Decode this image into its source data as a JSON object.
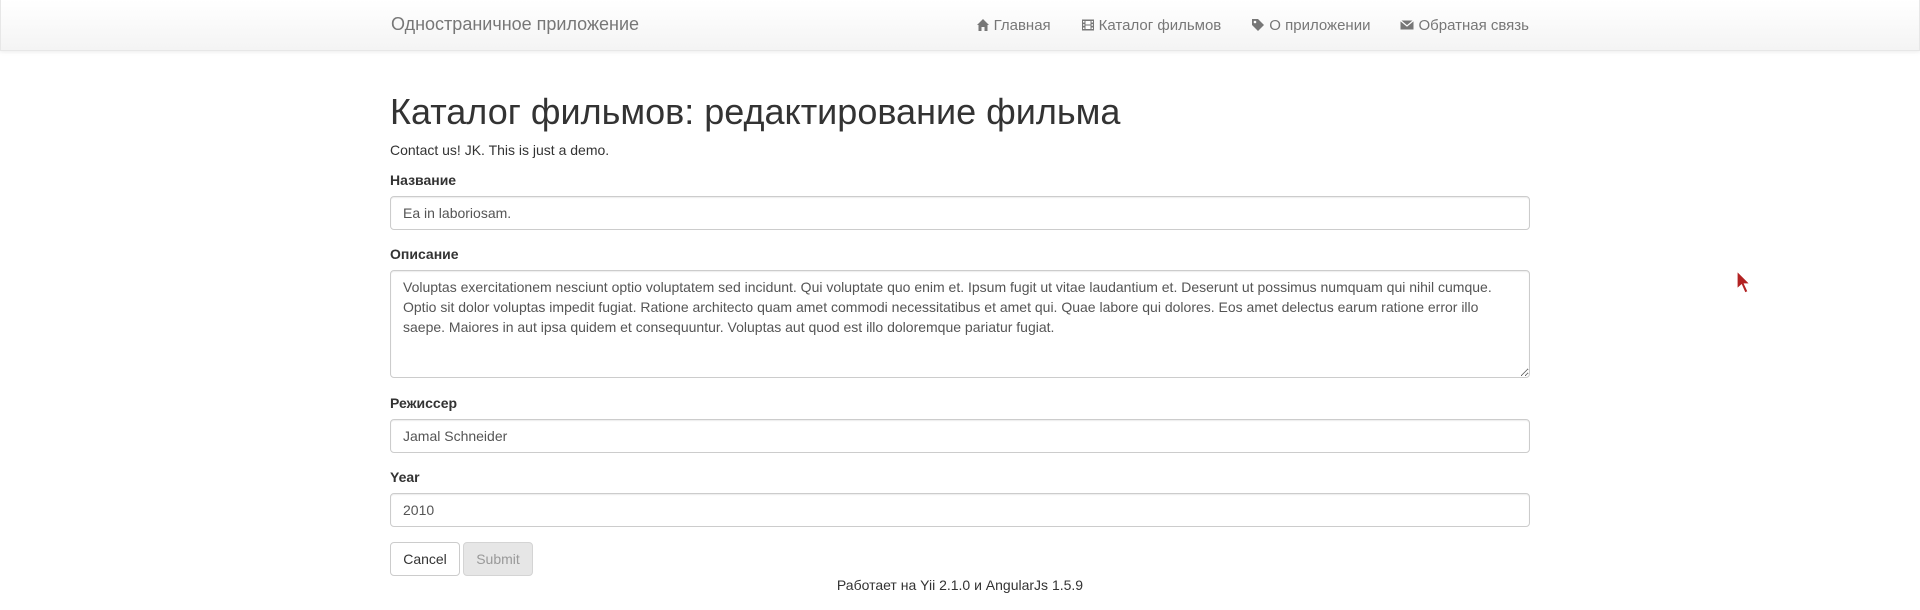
{
  "navbar": {
    "brand": "Одностраничное приложение",
    "items": [
      {
        "label": "Главная",
        "icon": "home-icon"
      },
      {
        "label": "Каталог фильмов",
        "icon": "film-icon"
      },
      {
        "label": "О приложении",
        "icon": "tag-icon"
      },
      {
        "label": "Обратная связь",
        "icon": "envelope-icon"
      }
    ]
  },
  "page": {
    "title": "Каталог фильмов: редактирование фильма",
    "lead": "Contact us! JK. This is just a demo."
  },
  "form": {
    "name_label": "Название",
    "name_value": "Ea in laboriosam.",
    "description_label": "Описание",
    "description_value": "Voluptas exercitationem nesciunt optio voluptatem sed incidunt. Qui voluptate quo enim et. Ipsum fugit ut vitae laudantium et. Deserunt ut possimus numquam qui nihil cumque. Optio sit dolor voluptas impedit fugiat. Ratione architecto quam amet commodi necessitatibus et amet qui. Quae labore qui dolores. Eos amet delectus earum ratione error illo saepe. Maiores in aut ipsa quidem et consequuntur. Voluptas aut quod est illo doloremque pariatur fugiat.",
    "director_label": "Режиссер",
    "director_value": "Jamal Schneider",
    "year_label": "Year",
    "year_value": "2010",
    "cancel_label": "Cancel",
    "submit_label": "Submit"
  },
  "footer": {
    "text": "Работает на Yii 2.1.0 и AngularJs 1.5.9"
  },
  "colors": {
    "text": "#333333",
    "nav_text": "#777777",
    "border": "#cccccc",
    "disabled_bg": "#e6e6e6"
  }
}
